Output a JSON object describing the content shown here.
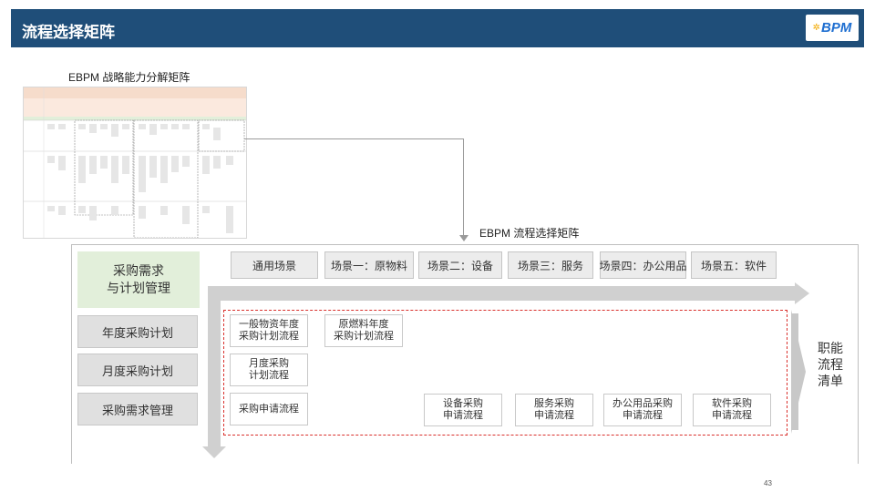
{
  "header": {
    "title": "流程选择矩阵",
    "logo_text": "BPM"
  },
  "captions": {
    "thumbnail": "EBPM 战略能力分解矩阵",
    "matrix": "EBPM 流程选择矩阵"
  },
  "category": {
    "line1": "采购需求",
    "line2": "与计划管理"
  },
  "side_items": [
    "年度采购计划",
    "月度采购计划",
    "采购需求管理"
  ],
  "scenarios": [
    "通用场景",
    "场景一：原物料",
    "场景二：设备",
    "场景三：服务",
    "场景四：办公用品",
    "场景五：软件"
  ],
  "processes": [
    {
      "line1": "一般物资年度",
      "line2": "采购计划流程"
    },
    {
      "line1": "原燃料年度",
      "line2": "采购计划流程"
    },
    {
      "line1": "月度采购",
      "line2": "计划流程"
    },
    {
      "line1": "采购申请流程",
      "line2": ""
    },
    {
      "line1": "设备采购",
      "line2": "申请流程"
    },
    {
      "line1": "服务采购",
      "line2": "申请流程"
    },
    {
      "line1": "办公用品采购",
      "line2": "申请流程"
    },
    {
      "line1": "软件采购",
      "line2": "申请流程"
    }
  ],
  "function_list": {
    "line1": "职能",
    "line2": "流程",
    "line3": "清单"
  },
  "page_number": "43",
  "colors": {
    "header": "#1f4e79",
    "category": "#e2efda",
    "dashed_border": "#d9302c",
    "arrow": "#d0d0d0"
  }
}
